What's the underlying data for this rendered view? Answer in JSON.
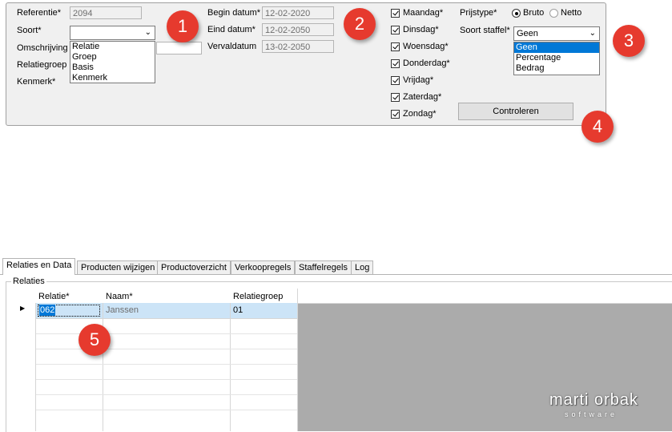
{
  "form": {
    "referentie": {
      "label": "Referentie*",
      "value": "2094"
    },
    "soort": {
      "label": "Soort*",
      "value": "",
      "options": [
        "Relatie",
        "Groep",
        "Basis",
        "Kenmerk"
      ]
    },
    "omschrijving": {
      "label": "Omschrijving"
    },
    "relatiegroep": {
      "label": "Relatiegroep"
    },
    "kenmerk": {
      "label": "Kenmerk*"
    },
    "begin_datum": {
      "label": "Begin datum*",
      "value": "12-02-2020"
    },
    "eind_datum": {
      "label": "Eind datum*",
      "value": "12-02-2050"
    },
    "vervaldatum": {
      "label": "Vervaldatum",
      "value": "13-02-2050"
    },
    "days": [
      {
        "label": "Maandag*",
        "checked": true
      },
      {
        "label": "Dinsdag*",
        "checked": true
      },
      {
        "label": "Woensdag*",
        "checked": true
      },
      {
        "label": "Donderdag*",
        "checked": true
      },
      {
        "label": "Vrijdag*",
        "checked": true
      },
      {
        "label": "Zaterdag*",
        "checked": true
      },
      {
        "label": "Zondag*",
        "checked": true
      }
    ],
    "prijstype": {
      "label": "Prijstype*",
      "options": [
        "Bruto",
        "Netto"
      ],
      "selected": "Bruto"
    },
    "soort_staffel": {
      "label": "Soort staffel*",
      "value": "Geen",
      "options": [
        "Geen",
        "Percentage",
        "Bedrag"
      ],
      "selected": "Geen"
    },
    "controleren_label": "Controleren"
  },
  "markers": [
    "1",
    "2",
    "3",
    "4",
    "5"
  ],
  "tabs": [
    "Relaties en Data",
    "Producten wijzigen",
    "Productoverzicht",
    "Verkoopregels",
    "Staffelregels",
    "Log"
  ],
  "active_tab": "Relaties en Data",
  "relaties": {
    "group_label": "Relaties",
    "columns": [
      "Relatie*",
      "Naam*",
      "Relatiegroep"
    ],
    "rows": [
      [
        "062",
        "Janssen",
        "01"
      ]
    ]
  },
  "watermark": {
    "line1": "marti orbak",
    "line2": "software"
  },
  "colors": {
    "marker": "#e63a2e",
    "selection": "#0078d7",
    "row_highlight": "#cce4f7"
  }
}
